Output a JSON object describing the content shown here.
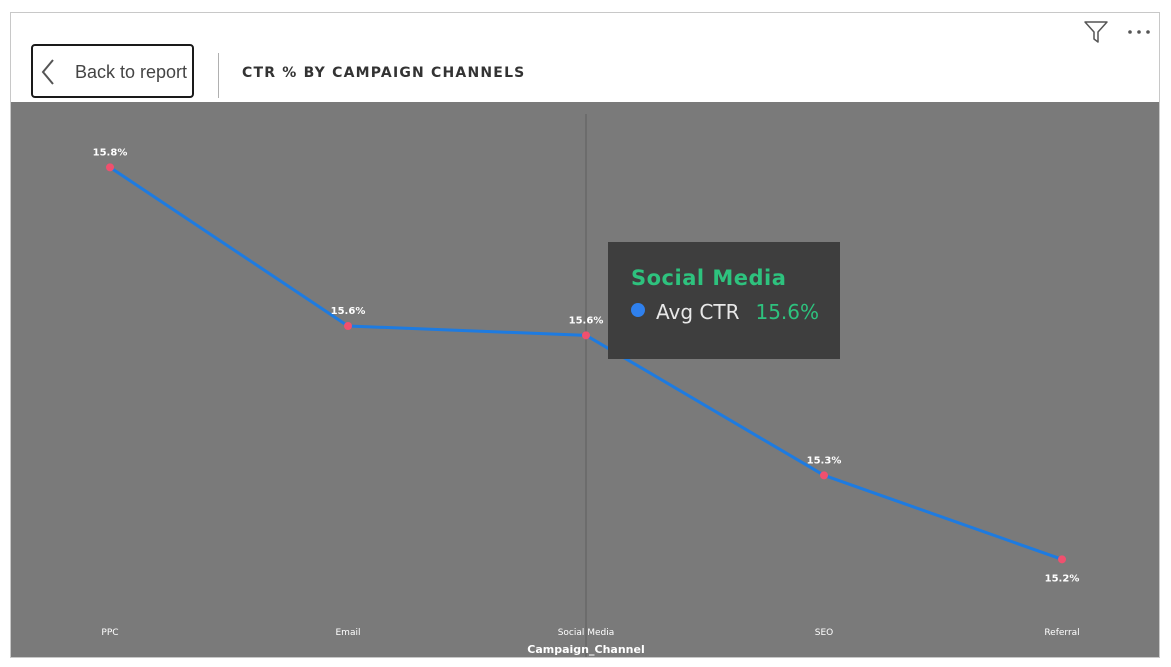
{
  "header": {
    "back_label": "Back to report",
    "title": "CTR % BY CAMPAIGN CHANNELS"
  },
  "toolbar": {
    "filter_icon": "filter-icon",
    "more_icon": "more-options-icon"
  },
  "tooltip": {
    "title": "Social Media",
    "series_label": "Avg CTR",
    "value": "15.6%"
  },
  "colors": {
    "plot_bg": "#7a7a7a",
    "line": "#1e7be0",
    "marker": "#f0506e",
    "tooltip_bg": "#3e3e3e",
    "tooltip_accent": "#2ec27e",
    "tooltip_dot": "#2f80ed"
  },
  "chart_data": {
    "type": "line",
    "categories": [
      "PPC",
      "Email",
      "Social Media",
      "SEO",
      "Referral"
    ],
    "series": [
      {
        "values": [
          15.79,
          15.62,
          15.61,
          15.46,
          15.37
        ]
      }
    ],
    "data_labels": [
      "15.8%",
      "15.6%",
      "15.6%",
      "15.3%",
      "15.2%"
    ],
    "xlabel": "Campaign_Channel",
    "ylabel": "",
    "ylim": [
      15.35,
      15.8
    ],
    "grid": false,
    "highlighted_category": "Social Media"
  }
}
